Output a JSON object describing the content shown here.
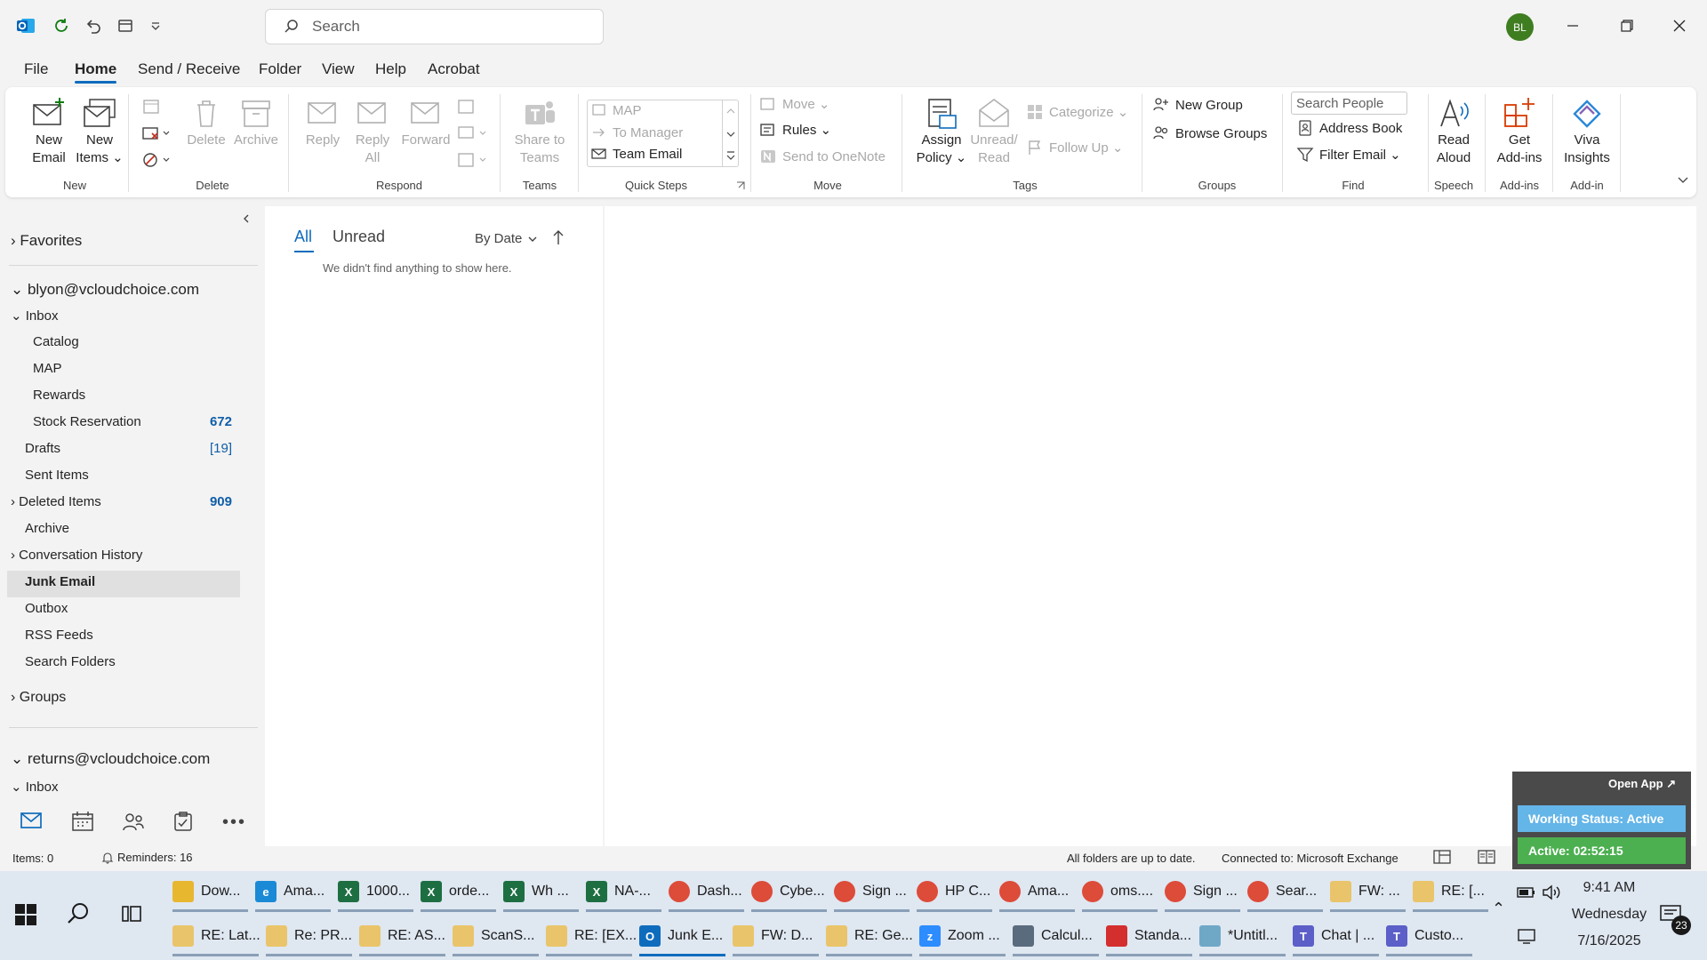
{
  "titlebar": {
    "search_placeholder": "Search",
    "avatar_initials": "BL"
  },
  "menu_tabs": [
    "File",
    "Home",
    "Send / Receive",
    "Folder",
    "View",
    "Help",
    "Acrobat"
  ],
  "ribbon": {
    "new_email": [
      "New",
      "Email"
    ],
    "new_items": [
      "New",
      "Items"
    ],
    "delete": "Delete",
    "archive": "Archive",
    "reply": "Reply",
    "reply_all": [
      "Reply",
      "All"
    ],
    "forward": "Forward",
    "share_teams": [
      "Share to",
      "Teams"
    ],
    "quick_steps": [
      "MAP",
      "To Manager",
      "Team Email"
    ],
    "move": "Move",
    "rules": "Rules",
    "send_onenote": "Send to OneNote",
    "assign_policy": [
      "Assign",
      "Policy"
    ],
    "unread_read": [
      "Unread/",
      "Read"
    ],
    "categorize": "Categorize",
    "follow_up": "Follow Up",
    "new_group": "New Group",
    "browse_groups": "Browse Groups",
    "search_people_placeholder": "Search People",
    "address_book": "Address Book",
    "filter_email": "Filter Email",
    "read_aloud": [
      "Read",
      "Aloud"
    ],
    "get_addins": [
      "Get",
      "Add-ins"
    ],
    "viva_insights": [
      "Viva",
      "Insights"
    ],
    "groups": {
      "new": "New",
      "delete": "Delete",
      "respond": "Respond",
      "teams": "Teams",
      "quick_steps": "Quick Steps",
      "move": "Move",
      "tags": "Tags",
      "groups": "Groups",
      "find": "Find",
      "speech": "Speech",
      "addins": "Add-ins",
      "addin": "Add-in"
    }
  },
  "folders": {
    "favorites": "Favorites",
    "account1": "blyon@vcloudchoice.com",
    "items": [
      {
        "label": "Inbox",
        "count": ""
      },
      {
        "label": "Catalog",
        "count": ""
      },
      {
        "label": "MAP",
        "count": ""
      },
      {
        "label": "Rewards",
        "count": ""
      },
      {
        "label": "Stock Reservation",
        "count": "672"
      },
      {
        "label": "Drafts",
        "count": "[19]"
      },
      {
        "label": "Sent Items",
        "count": ""
      },
      {
        "label": "Deleted Items",
        "count": "909"
      },
      {
        "label": "Archive",
        "count": ""
      },
      {
        "label": "Conversation History",
        "count": ""
      },
      {
        "label": "Junk Email",
        "count": ""
      },
      {
        "label": "Outbox",
        "count": ""
      },
      {
        "label": "RSS Feeds",
        "count": ""
      },
      {
        "label": "Search Folders",
        "count": ""
      }
    ],
    "groups": "Groups",
    "account2": "returns@vcloudchoice.com",
    "account2_inbox": "Inbox"
  },
  "message_list": {
    "tab_all": "All",
    "tab_unread": "Unread",
    "sort": "By Date",
    "empty": "We didn't find anything to show here."
  },
  "statusbar": {
    "items": "Items: 0",
    "reminders": "Reminders: 16",
    "sync": "All folders are up to date.",
    "connection": "Connected to: Microsoft Exchange"
  },
  "widget": {
    "open_app": "Open App",
    "working_status": "Working Status: Active",
    "active_time": "Active: 02:52:15"
  },
  "taskbar": {
    "row1": [
      {
        "label": "Dow...",
        "icon": "folder"
      },
      {
        "label": "Ama...",
        "icon": "edge"
      },
      {
        "label": "1000...",
        "icon": "excel"
      },
      {
        "label": "orde...",
        "icon": "excel"
      },
      {
        "label": "Wh ...",
        "icon": "excel"
      },
      {
        "label": "NA-...",
        "icon": "excel"
      },
      {
        "label": "Dash...",
        "icon": "chrome"
      },
      {
        "label": "Cybe...",
        "icon": "chrome"
      },
      {
        "label": "Sign ...",
        "icon": "chrome"
      },
      {
        "label": "HP C...",
        "icon": "chrome"
      },
      {
        "label": "Ama...",
        "icon": "chrome"
      },
      {
        "label": "oms....",
        "icon": "chrome"
      },
      {
        "label": "Sign ...",
        "icon": "chrome"
      },
      {
        "label": "Sear...",
        "icon": "chrome"
      },
      {
        "label": "FW: ...",
        "icon": "mail"
      },
      {
        "label": "RE: [...",
        "icon": "mail"
      }
    ],
    "row2": [
      {
        "label": "RE: Lat...",
        "icon": "mail"
      },
      {
        "label": "Re: PR...",
        "icon": "mail"
      },
      {
        "label": "RE: AS...",
        "icon": "mail"
      },
      {
        "label": "ScanS...",
        "icon": "mail"
      },
      {
        "label": "RE: [EX...",
        "icon": "mail"
      },
      {
        "label": "Junk E...",
        "icon": "outlook"
      },
      {
        "label": "FW: D...",
        "icon": "mail"
      },
      {
        "label": "RE: Ge...",
        "icon": "mail"
      },
      {
        "label": "Zoom ...",
        "icon": "zoom"
      },
      {
        "label": "Calcul...",
        "icon": "calc"
      },
      {
        "label": "Standa...",
        "icon": "pdf"
      },
      {
        "label": "*Untitl...",
        "icon": "paint"
      },
      {
        "label": "Chat | ...",
        "icon": "teams"
      },
      {
        "label": "Custo...",
        "icon": "teams"
      }
    ],
    "clock_time": "9:41 AM",
    "clock_day": "Wednesday",
    "clock_date": "7/16/2025",
    "notifications": "23"
  },
  "colors": {
    "accent": "#0f6cbd",
    "count_blue": "#0f5ea8",
    "avatar": "#3f7d21",
    "widget_green": "#4caf50"
  }
}
